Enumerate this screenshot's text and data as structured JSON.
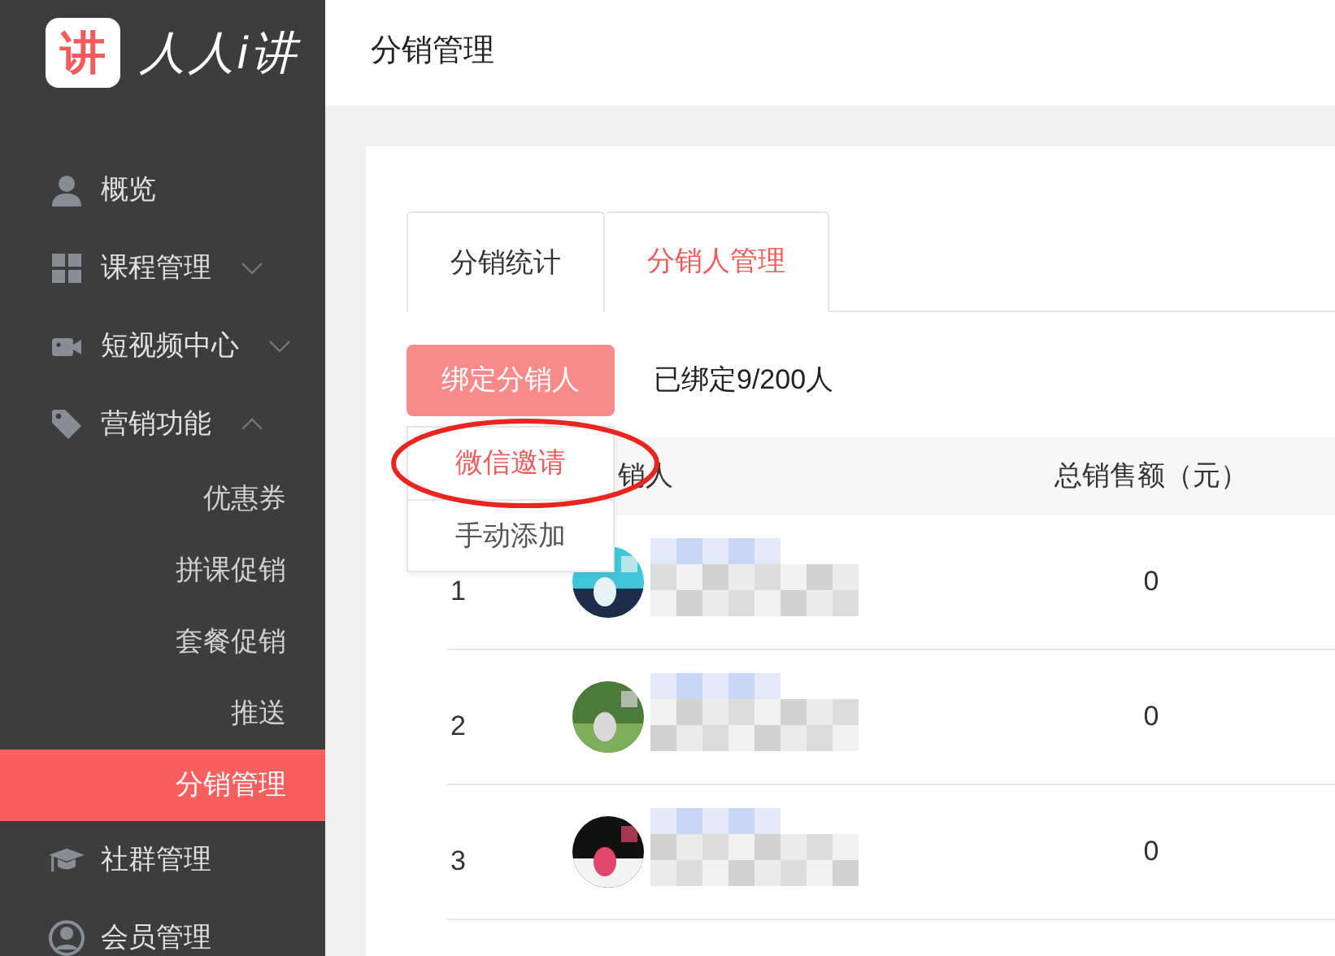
{
  "logo": {
    "badge": "讲",
    "text": "人人i讲"
  },
  "sidebar": {
    "items": [
      {
        "label": "概览",
        "selected": false
      },
      {
        "label": "课程管理",
        "selected": false,
        "expanded": false
      },
      {
        "label": "短视频中心",
        "selected": false,
        "expanded": false
      },
      {
        "label": "营销功能",
        "selected": false,
        "expanded": true,
        "children": [
          {
            "label": "优惠券",
            "selected": false
          },
          {
            "label": "拼课促销",
            "selected": false
          },
          {
            "label": "套餐促销",
            "selected": false
          },
          {
            "label": "推送",
            "selected": false
          },
          {
            "label": "分销管理",
            "selected": true
          }
        ]
      },
      {
        "label": "社群管理",
        "selected": false
      },
      {
        "label": "会员管理",
        "selected": false
      }
    ]
  },
  "header": {
    "title": "分销管理"
  },
  "tabs": [
    {
      "label": "分销统计",
      "selected": false
    },
    {
      "label": "分销人管理",
      "selected": true
    }
  ],
  "toolbar": {
    "button": "绑定分销人",
    "count": "已绑定9/200人"
  },
  "dropdown": {
    "items": [
      {
        "label": "微信邀请",
        "hovered": true,
        "circled": true
      },
      {
        "label": "手动添加",
        "hovered": false,
        "circled": false
      }
    ]
  },
  "table": {
    "columns": [
      "销人",
      "总销售额（元）"
    ],
    "rows": [
      {
        "index": "1",
        "amount": "0"
      },
      {
        "index": "2",
        "amount": "0"
      },
      {
        "index": "3",
        "amount": "0"
      }
    ]
  }
}
